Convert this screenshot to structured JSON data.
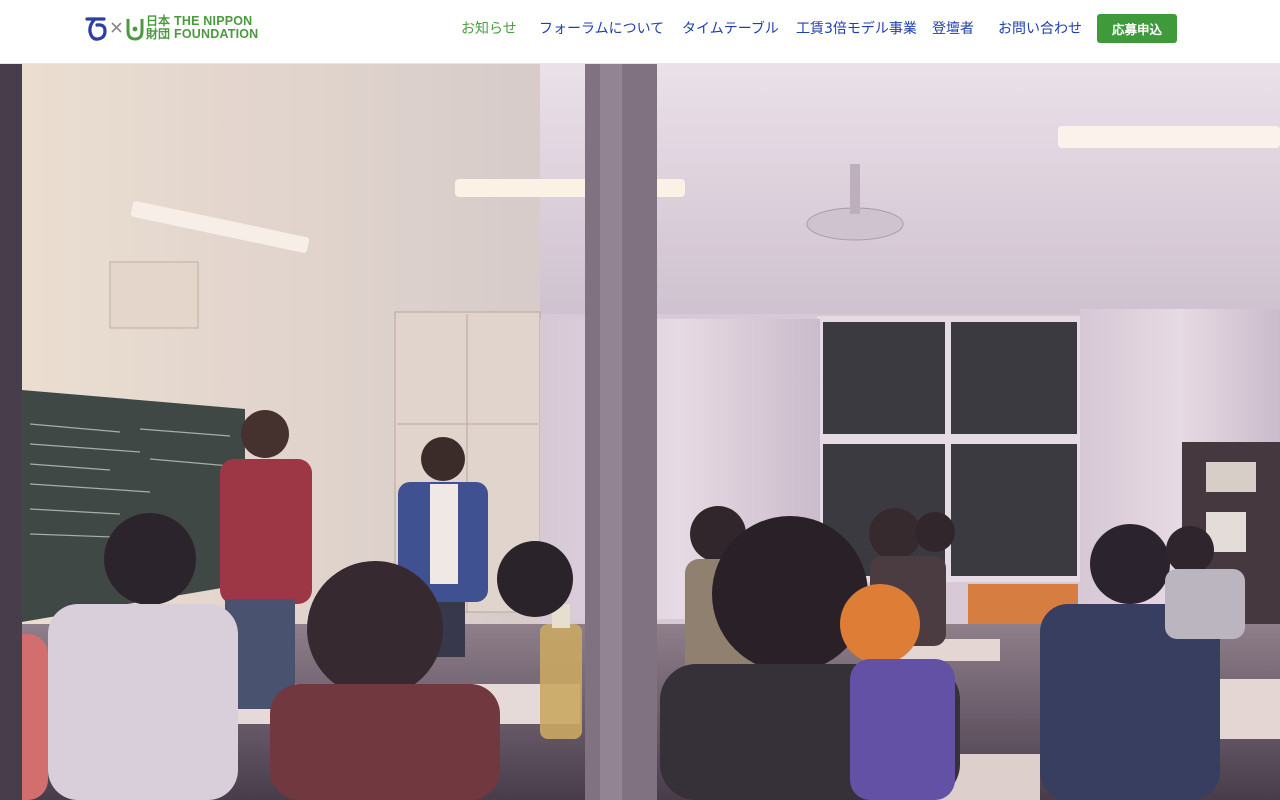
{
  "header": {
    "logo": {
      "name_line1": "THE NIPPON",
      "name_line2": "FOUNDATION",
      "kanji_top": "日本",
      "kanji_bottom": "財団",
      "separator": "×"
    },
    "nav": [
      {
        "label": "お知らせ",
        "active": true
      },
      {
        "label": "フォーラムについて",
        "active": false
      },
      {
        "label": "タイムテーブル",
        "active": false
      },
      {
        "label": "工賃3倍モデル事業",
        "active": false
      },
      {
        "label": "登壇者",
        "active": false
      },
      {
        "label": "お問い合わせ",
        "active": false
      }
    ],
    "apply_button": "応募申込"
  },
  "hero": {
    "subject": "photo-classroom-meeting"
  },
  "colors": {
    "nav_link": "#1f3fae",
    "nav_active": "#4e9d45",
    "apply_button": "#3f9a3c",
    "logo_green": "#4a9a3e",
    "logo_blue": "#2b3ea6"
  }
}
